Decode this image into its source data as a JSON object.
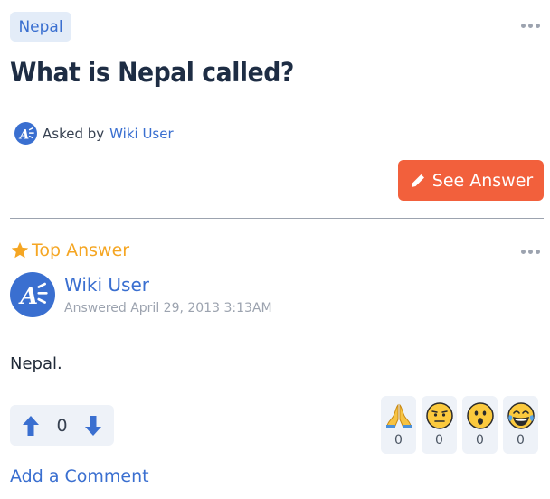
{
  "question": {
    "tag": "Nepal",
    "title": "What is Nepal called?",
    "asked_prefix": "Asked by",
    "asked_by": "Wiki User",
    "see_answer_label": "See Answer"
  },
  "answer": {
    "section_label": "Top Answer",
    "user": "Wiki User",
    "answered_at": "Answered April 29, 2013 3:13AM",
    "text": "Nepal.",
    "vote_count": "0",
    "reactions": [
      {
        "icon": "folded-hands-icon",
        "count": "0"
      },
      {
        "icon": "neutral-face-icon",
        "count": "0"
      },
      {
        "icon": "surprised-face-icon",
        "count": "0"
      },
      {
        "icon": "laughing-tears-icon",
        "count": "0"
      }
    ],
    "add_comment_label": "Add a Comment"
  },
  "colors": {
    "accent": "#3a6fd0",
    "cta": "#f2603c",
    "star": "#f5a623"
  }
}
